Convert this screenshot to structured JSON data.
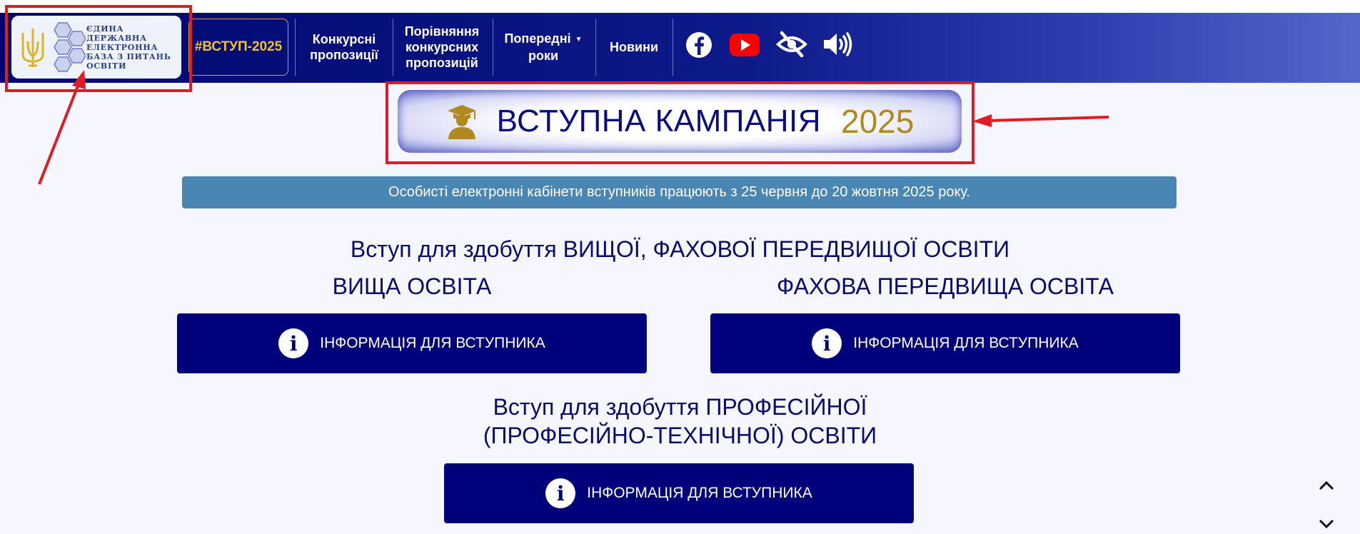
{
  "logo": {
    "lines": [
      "ЄДИНА",
      "ДЕРЖАВНА",
      "ЕЛЕКТРОННА",
      "БАЗА З ПИТАНЬ",
      "ОСВІТИ"
    ],
    "icon": "trident-icon"
  },
  "nav": {
    "vstup": "#ВСТУП-2025",
    "items": [
      {
        "line1": "Конкурсні",
        "line2": "пропозиції",
        "line3": ""
      },
      {
        "line1": "Порівняння",
        "line2": "конкурсних",
        "line3": "пропозицій"
      },
      {
        "line1": "Попередні",
        "line2": "роки",
        "line3": ""
      },
      {
        "line1": "Новини",
        "line2": "",
        "line3": ""
      }
    ],
    "social_icons": [
      "facebook-icon",
      "youtube-icon",
      "eye-slash-icon",
      "volume-icon"
    ]
  },
  "banner": {
    "title": "ВСТУПНА КАМПАНІЯ",
    "year": "2025",
    "icon": "graduate-icon"
  },
  "notice": "Особисті електронні кабінети вступників працюють з 25 червня до 20 жовтня 2025 року.",
  "sections": {
    "higher_heading": "Вступ для здобуття ВИЩОЇ, ФАХОВОЇ ПЕРЕДВИЩОЇ ОСВІТИ",
    "higher_label": "ВИЩА ОСВІТА",
    "prehigher_label": "ФАХОВА ПЕРЕДВИЩА ОСВІТА",
    "vocational_line1": "Вступ для здобуття ПРОФЕСІЙНОЇ",
    "vocational_line2": "(ПРОФЕСІЙНО-ТЕХНІЧНОЇ) ОСВІТИ",
    "info_button": "ІНФОРМАЦІЯ ДЛЯ ВСТУПНИКА",
    "info_icon_glyph": "i"
  },
  "colors": {
    "nav_dark": "#00066e",
    "gold": "#b08a1e",
    "button_navy": "#00007a",
    "notice_blue": "#4a86b4",
    "annotation_red": "#e01b24"
  }
}
